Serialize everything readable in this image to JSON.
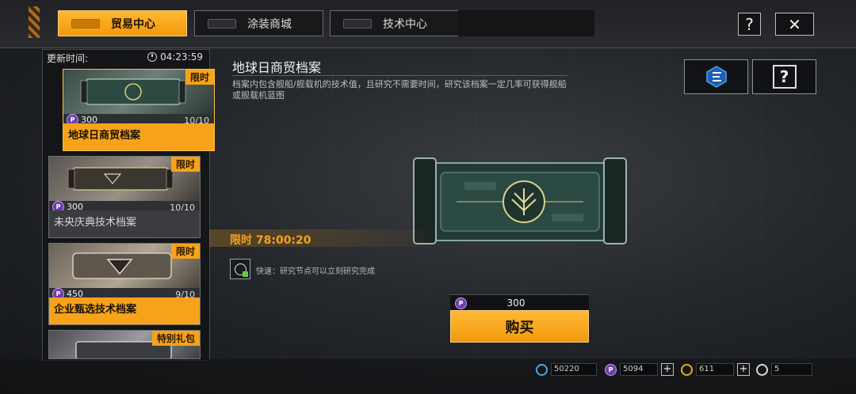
{
  "tabs": [
    {
      "label": "贸易中心",
      "active": true
    },
    {
      "label": "涂装商城",
      "active": false
    },
    {
      "label": "技术中心",
      "active": false
    }
  ],
  "top_buttons": {
    "help": "?",
    "close": "✕"
  },
  "sidebar": {
    "refresh_label": "更新时间:",
    "countdown": "04:23:59",
    "items": [
      {
        "tag": "限时",
        "price": "300",
        "count": "10/10",
        "name": "地球日商贸档案",
        "selected": true
      },
      {
        "tag": "限时",
        "price": "300",
        "count": "10/10",
        "name": "未央庆典技术档案",
        "selected": false
      },
      {
        "tag": "限时",
        "price": "450",
        "count": "9/10",
        "name": "企业甄选技术档案",
        "selected": false
      },
      {
        "tag": "特别礼包",
        "price": "",
        "count": "",
        "name": "",
        "selected": false
      }
    ]
  },
  "detail": {
    "title": "地球日商贸档案",
    "description": "档案内包含舰船/舰载机的技术值，且研究不需要时间，研究该档案一定几率可获得舰船或舰载机蓝图",
    "limit": "限时 78:00:20",
    "quick_text": "快速：研究节点可以立刻研究完成",
    "cost": "300",
    "buy_label": "购买"
  },
  "currencies": [
    {
      "icon": "blue-ring-icon",
      "value": "50220",
      "plus": false
    },
    {
      "icon": "purple-p-icon",
      "value": "5094",
      "plus": true
    },
    {
      "icon": "gold-coin-icon",
      "value": "611",
      "plus": true
    },
    {
      "icon": "grey-token-icon",
      "value": "5",
      "plus": false
    }
  ],
  "colors": {
    "accent": "#f6a21b",
    "panel": "#141517",
    "purple": "#6b3ea8"
  }
}
